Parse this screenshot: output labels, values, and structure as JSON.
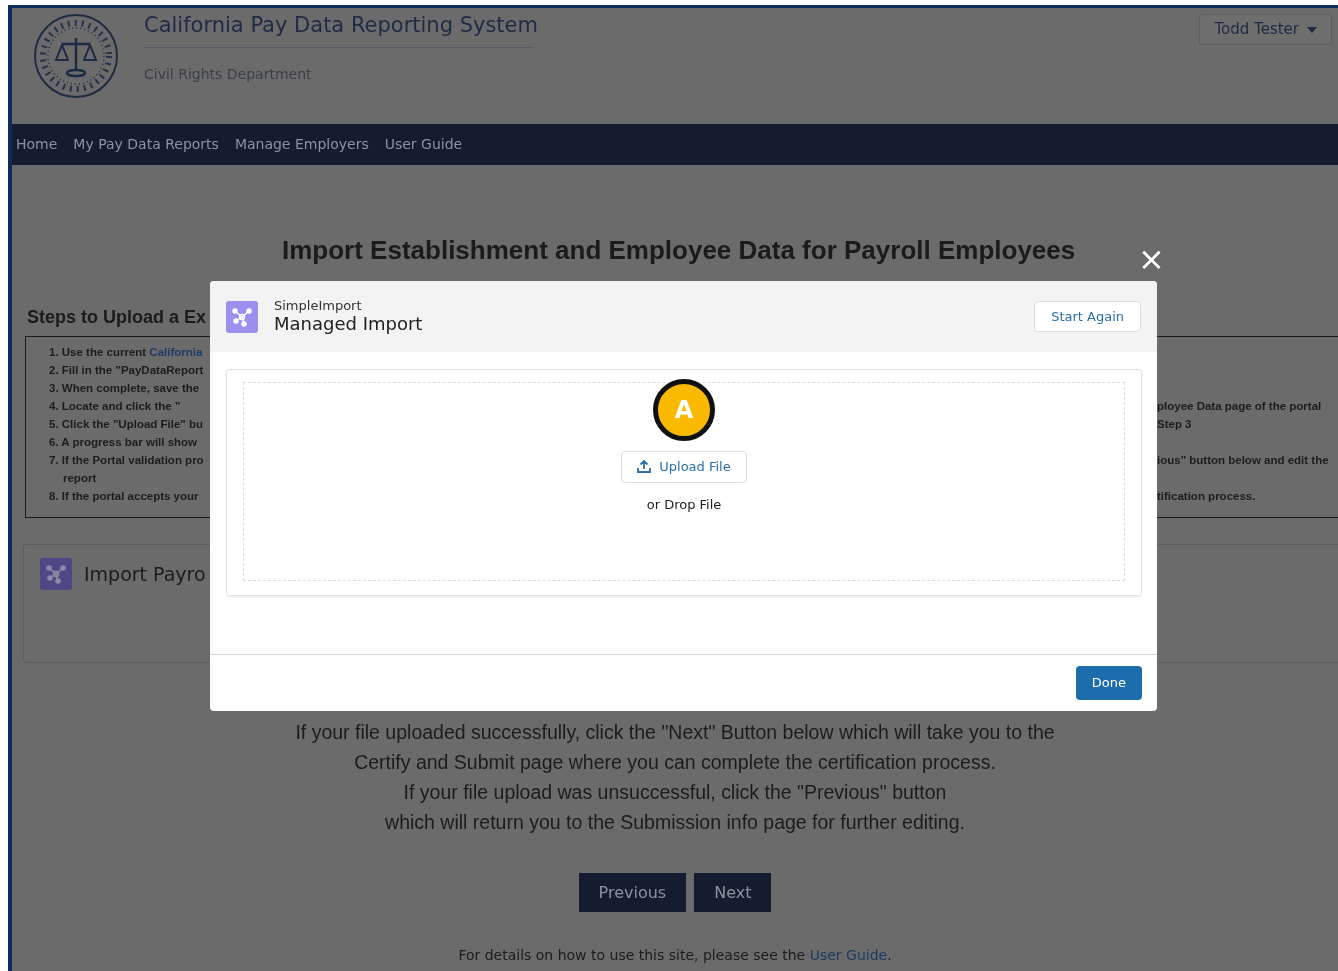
{
  "header": {
    "title": "California Pay Data Reporting System",
    "subtitle": "Civil Rights Department",
    "user_menu": {
      "label": "Todd Tester"
    }
  },
  "nav": [
    {
      "label": "Home"
    },
    {
      "label": "My Pay Data Reports"
    },
    {
      "label": "Manage Employers"
    },
    {
      "label": "User Guide"
    }
  ],
  "page": {
    "title": "Import Establishment and Employee Data for Payroll Employees",
    "close": "×",
    "steps": {
      "heading": "Steps to Upload a Ex",
      "rows": [
        {
          "kind": "item",
          "left": "1. Use the current ",
          "link": "California",
          "right": ""
        },
        {
          "kind": "item",
          "left": "2. Fill in the \"PayDataReport",
          "right": ""
        },
        {
          "kind": "item",
          "left": "3. When complete, save the",
          "right": ""
        },
        {
          "kind": "item",
          "left": "4. Locate and click the \"",
          "right": "ployee Data page of the portal"
        },
        {
          "kind": "item",
          "left": "5. Click the \"Upload File\" bu",
          "right": "Step 3"
        },
        {
          "kind": "item",
          "left": "6. A progress bar will show",
          "right": ""
        },
        {
          "kind": "item",
          "left": "7. If the Portal validation pro",
          "right": "ious\" button below and edit the"
        },
        {
          "kind": "continuation",
          "left": "report",
          "right": ""
        },
        {
          "kind": "item",
          "left": "8. If the portal accepts your",
          "right": "tification process."
        }
      ]
    },
    "import_card": {
      "title": "Import Payro"
    },
    "instructions": [
      "If your file uploaded successfully, click the \"Next\" Button below which will take you to the",
      "Certify and Submit page where you can complete the certification process.",
      "If your file upload was unsuccessful, click the \"Previous\" button",
      "which will return you to the Submission info page for further editing."
    ],
    "buttons": [
      {
        "label": "Previous"
      },
      {
        "label": "Next"
      }
    ],
    "footer": {
      "text": "For details on how to use this site, please see the ",
      "link": "User Guide",
      "end": "."
    }
  },
  "modal": {
    "app": "SimpleImport",
    "title": "Managed Import",
    "start_again": "Start Again",
    "callout": "A",
    "upload": "Upload File",
    "drop": "or Drop File",
    "done": "Done"
  }
}
